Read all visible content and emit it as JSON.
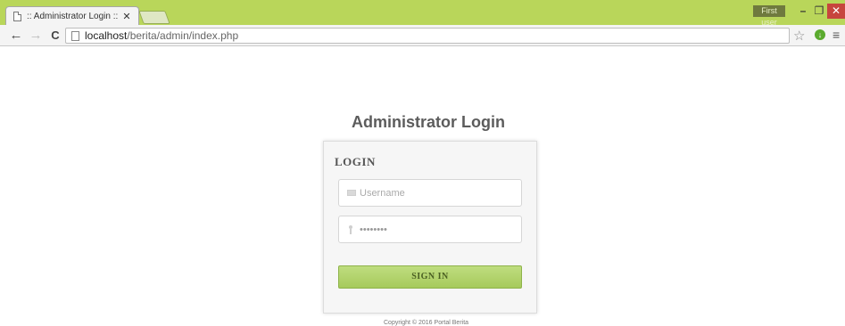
{
  "browser": {
    "tab_title": ":: Administrator Login ::",
    "tab_close": "✕",
    "user_badge": "First user",
    "url_host": "localhost",
    "url_path": "/berita/admin/index.php"
  },
  "page": {
    "heading": "Administrator Login",
    "login_title": "LOGIN",
    "username_placeholder": "Username",
    "password_value": "••••••••",
    "signin_label": "SIGN IN",
    "copyright": "Copyright © 2016 Portal Berita"
  },
  "colors": {
    "chrome_accent": "#b9d65a",
    "button_green": "#a6ca5c"
  }
}
